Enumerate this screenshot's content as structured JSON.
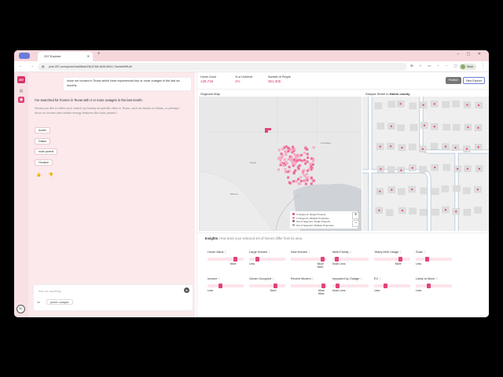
{
  "browser": {
    "tab_title": "257 Explore",
    "url": "pink.257.co/explore/chat/8bde236-6768-4636-8510-7ba4a9d9f1a5",
    "profile_name": "Work"
  },
  "chat": {
    "user_message": "show me houses in Texas which have experienced two or more outages in the last six months",
    "assistant_message": "I've searched for homes in Texas with 2 or more outages in the last month.",
    "assistant_suggestion": "Would you like to refine your search by looking at specific cities in Texas, such as Austin or Dallas, or perhaps focus on homes with certain energy features like solar panels?",
    "chips": [
      "Austin",
      "Dallas",
      "solar panels",
      "Houston"
    ],
    "input_placeholder": "Ask me anything...",
    "mode_label": "1x",
    "filter_tag": "power outages"
  },
  "stats": [
    {
      "label": "Home Count",
      "value": "138,746"
    },
    {
      "label": "% of Universe",
      "value": "1%"
    },
    {
      "label": "Number of People",
      "value": "351,305"
    }
  ],
  "actions": {
    "publish": "Publish",
    "new_explore": "New Explore"
  },
  "segment_map": {
    "title": "Segment Map",
    "legend": [
      "In Segment, Single Property",
      "In Segment, Multiple Properties",
      "Out of Segment, Single Property",
      "Out of Segment, Multiple Properties"
    ],
    "zoom_in": "+",
    "zoom_out": "−"
  },
  "sample_street": {
    "title_prefix": "Sample Street in",
    "county": "Harris county"
  },
  "insights": {
    "title": "Insights",
    "subtitle": "How does your selected set of homes differ from its area",
    "row1": [
      {
        "label": "Home Value",
        "caption": "More",
        "level": 0.8
      },
      {
        "label": "Large Homes",
        "caption": "Less",
        "level": 0.2
      },
      {
        "label": "New Homes",
        "caption": "Much More",
        "level": 0.92
      },
      {
        "label": "Multi-Family",
        "caption": "Much Less",
        "level": 0.08
      },
      {
        "label": "Yearly kWh Usage",
        "caption": "More",
        "level": 0.75
      },
      {
        "label": "Solar",
        "caption": "Less",
        "level": 0.3
      }
    ],
    "row2": [
      {
        "label": "Income",
        "caption": "Less",
        "level": 0.35
      },
      {
        "label": "Owner Occupied",
        "caption": "More",
        "level": 0.75
      },
      {
        "label": "Recent Movers",
        "caption": "Much More",
        "level": 0.95
      },
      {
        "label": "Impacted by Outage",
        "caption": "Much Less",
        "level": 0.1
      },
      {
        "label": "EV",
        "caption": "Less",
        "level": 0.3
      },
      {
        "label": "Likely to Move",
        "caption": "Less",
        "level": 0.35
      }
    ]
  },
  "colors": {
    "accent": "#e0447a",
    "map_segment": "#f06b9b"
  }
}
